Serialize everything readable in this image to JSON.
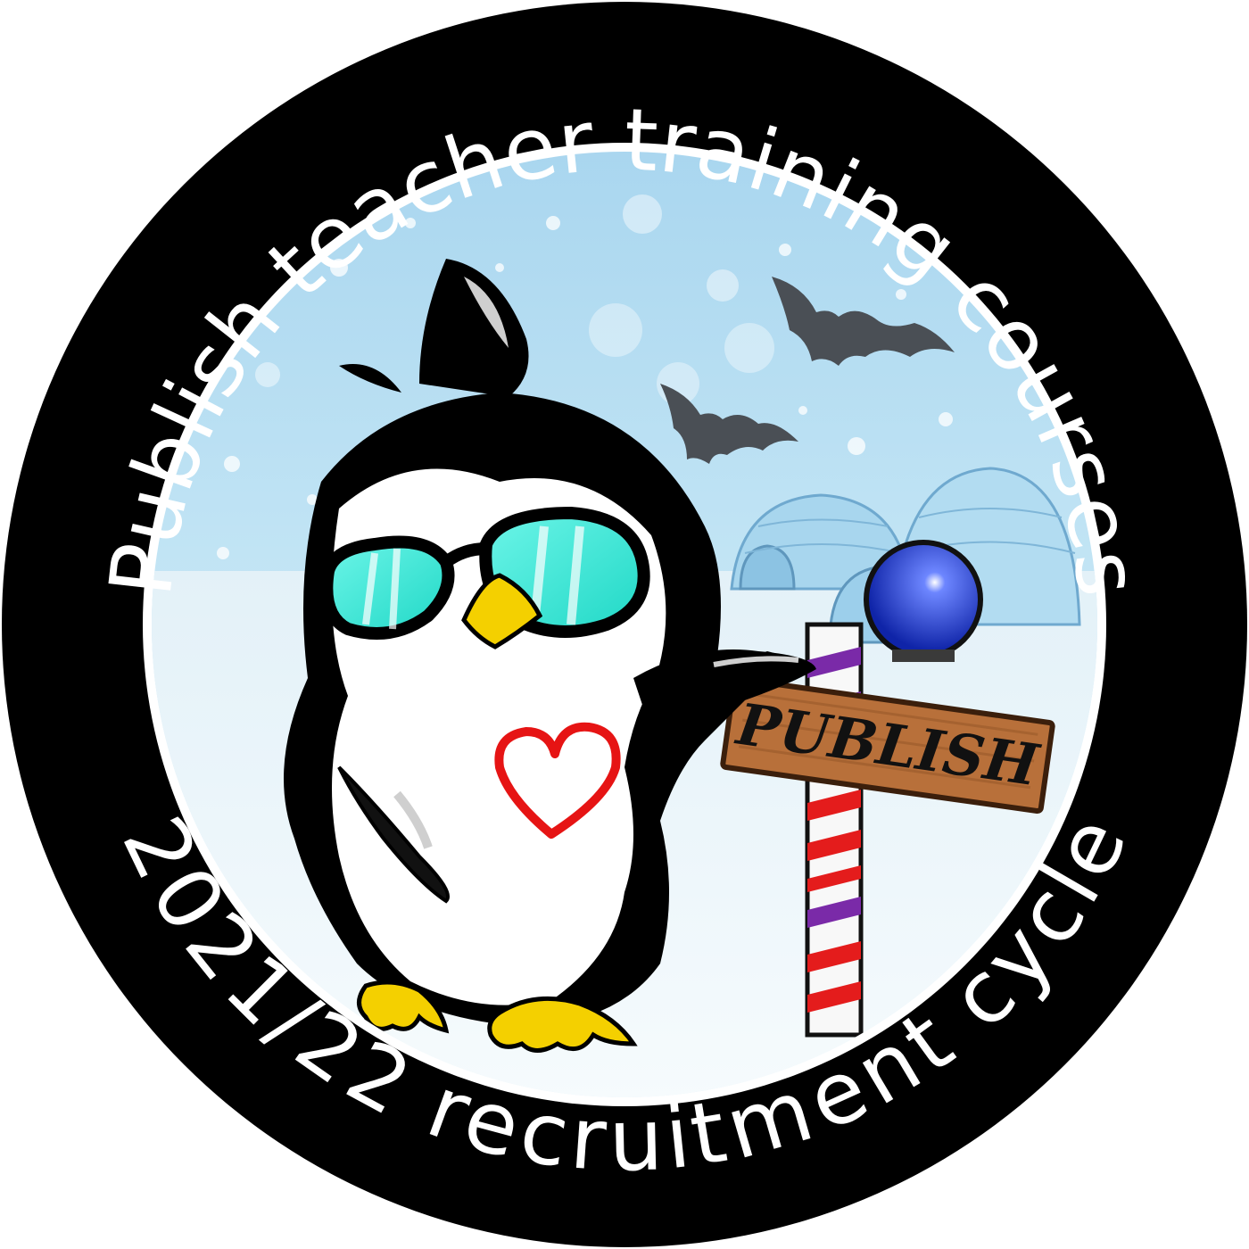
{
  "badge": {
    "top_text": "Publish teacher training courses",
    "bottom_text": "2021/22 recruitment cycle",
    "sign_text": "PUBLISH"
  },
  "colors": {
    "ring": "#000000",
    "ring_text": "#ffffff",
    "sky": "#bfe3f3",
    "snow_ground": "#e9f4fa",
    "igloo": "#a9d8ee",
    "penguin_body": "#000000",
    "penguin_belly": "#ffffff",
    "goggles": "#2ee8d8",
    "beak_feet": "#f4d000",
    "heart": "#e61414",
    "sign_wood": "#b8703a",
    "pole_stripe_purple": "#7a2aa8",
    "pole_stripe_red": "#e41c1c",
    "pole_ball": "#1a34c8",
    "bat": "#4a4f55"
  },
  "icons": [
    "penguin-icon",
    "bat-icon",
    "igloo-icon",
    "heart-icon",
    "signpost-icon"
  ]
}
